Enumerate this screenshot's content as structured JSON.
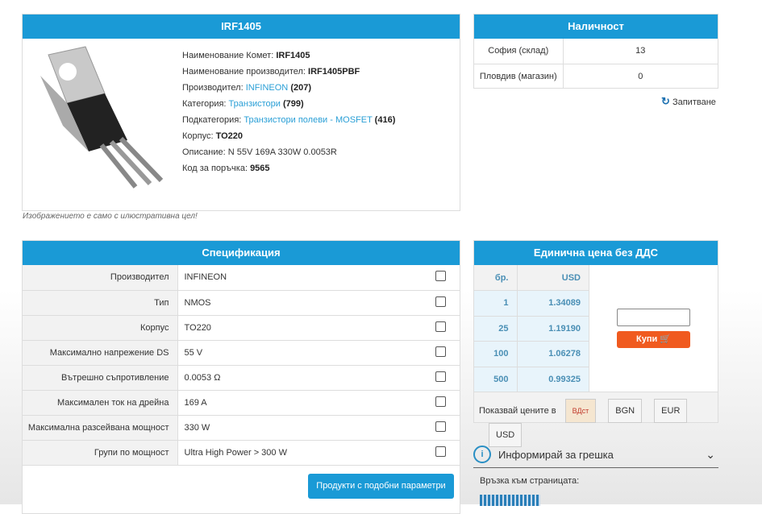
{
  "product": {
    "title": "IRF1405",
    "lines": [
      {
        "label": "Наименование Комет: ",
        "value": "IRF1405"
      },
      {
        "label": "Наименование производител: ",
        "value": "IRF1405PBF"
      },
      {
        "label": "Производител: ",
        "link": "INFINEON",
        "count": "(207)"
      },
      {
        "label": "Категория: ",
        "link": "Транзистори",
        "count": "(799)"
      },
      {
        "label": "Подкатегория: ",
        "link": "Транзистори полеви - MOSFET",
        "count": "(416)"
      },
      {
        "label": "Корпус: ",
        "value": "TO220"
      },
      {
        "label": "Описание: N 55V 169A 330W 0.0053R"
      },
      {
        "label": "Код за поръчка: ",
        "value": "9565"
      }
    ],
    "caption": "Изображението е само с илюстративна цел!"
  },
  "availability": {
    "title": "Наличност",
    "rows": [
      {
        "store": "София (склад)",
        "qty": "13"
      },
      {
        "store": "Пловдив (магазин)",
        "qty": "0"
      }
    ],
    "inquiry": "Запитване"
  },
  "specs": {
    "title": "Спецификация",
    "rows": [
      {
        "label": "Производител",
        "value": "INFINEON"
      },
      {
        "label": "Тип",
        "value": "NMOS"
      },
      {
        "label": "Корпус",
        "value": "TO220"
      },
      {
        "label": "Максимално напрежение DS",
        "value": "55 V"
      },
      {
        "label": "Вътрешно съпротивление",
        "value": "0.0053 Ω"
      },
      {
        "label": "Максимален ток на дрейна",
        "value": "169 A"
      },
      {
        "label": "Максимална разсейвана мощност",
        "value": "330 W"
      },
      {
        "label": "Групи по мощност",
        "value": "Ultra High Power > 300 W"
      }
    ],
    "similar_button": "Продукти с подобни параметри"
  },
  "price": {
    "title": "Единична цена без ДДС",
    "col_qty": "бр.",
    "col_cur": "USD",
    "rows": [
      {
        "qty": "1",
        "price": "1.34089"
      },
      {
        "qty": "25",
        "price": "1.19190"
      },
      {
        "qty": "100",
        "price": "1.06278"
      },
      {
        "qty": "500",
        "price": "0.99325"
      }
    ],
    "buy_label": "Купи",
    "show_in": "Показвай цените в",
    "currencies": [
      "ВДст",
      "BGN",
      "EUR",
      "USD"
    ]
  },
  "report": {
    "label": "Информирай за грешка",
    "page_link": "Връзка към страницата:"
  },
  "colors": {
    "accent": "#1a9ad6",
    "buy": "#f05a1f"
  }
}
